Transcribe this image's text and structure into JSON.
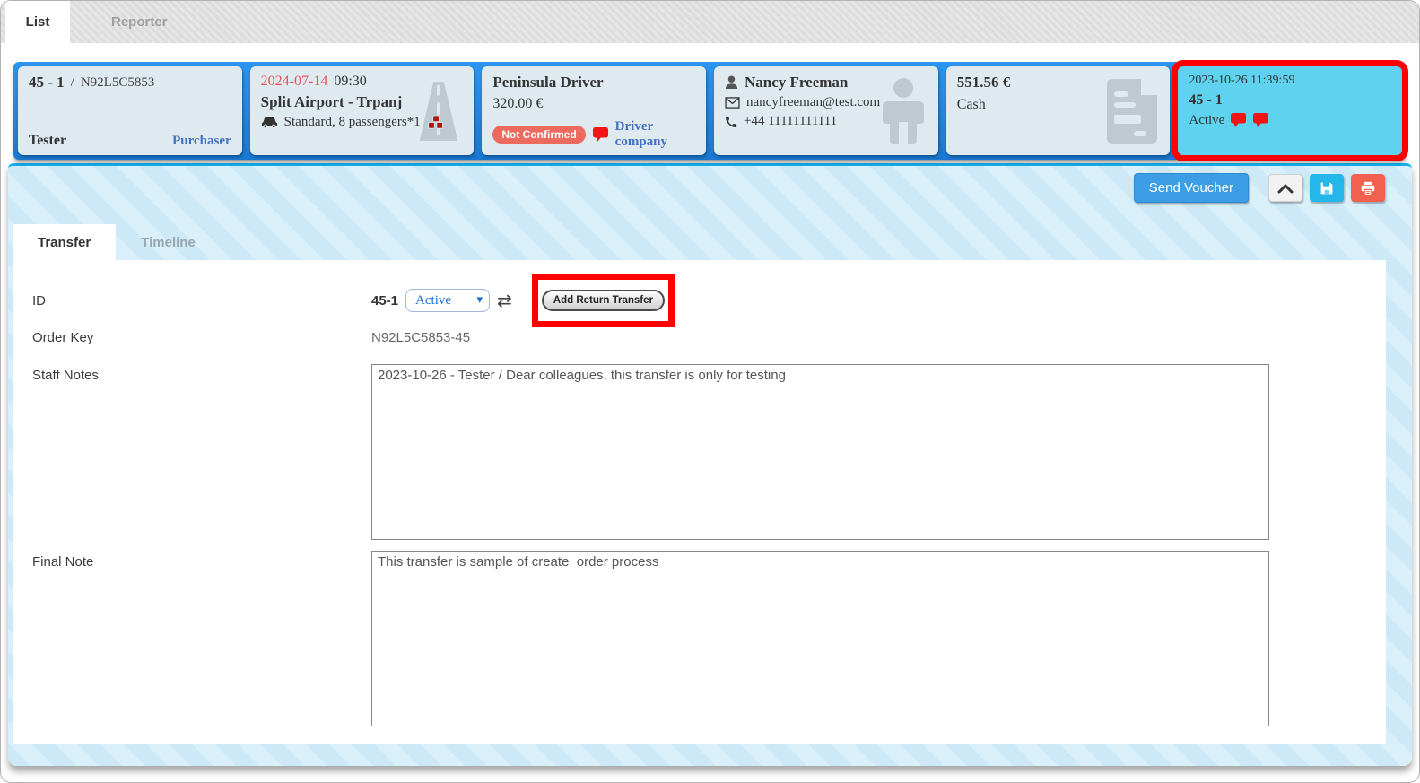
{
  "top_tabs": [
    {
      "label": "List"
    },
    {
      "label": "Reporter"
    }
  ],
  "cards": {
    "order": {
      "id": "45 - 1",
      "sep": "/",
      "code": "N92L5C5853",
      "customer": "Tester",
      "role_link": "Purchaser"
    },
    "trip": {
      "date": "2024-07-14",
      "time": "09:30",
      "route": "Split Airport - Trpanj",
      "vehicle": "Standard, 8 passengers*1"
    },
    "driver": {
      "name": "Peninsula Driver",
      "price": "320.00 €",
      "status_badge": "Not Confirmed",
      "company_link": "Driver company"
    },
    "customer": {
      "name": "Nancy Freeman",
      "email": "nancyfreeman@test.com",
      "phone": "+44 11111111111"
    },
    "payment": {
      "amount": "551.56 €",
      "method": "Cash"
    },
    "status": {
      "created": "2023-10-26 11:39:59",
      "id": "45 - 1",
      "state": "Active"
    }
  },
  "toolbar": {
    "send_voucher": "Send Voucher"
  },
  "detail_tabs": [
    {
      "label": "Transfer"
    },
    {
      "label": "Timeline"
    }
  ],
  "form": {
    "id": {
      "label": "ID",
      "value": "45-1",
      "status": "Active",
      "add_return": "Add Return Transfer"
    },
    "order_key": {
      "label": "Order Key",
      "value": "N92L5C5853-45"
    },
    "staff_notes": {
      "label": "Staff Notes",
      "value": "2023-10-26 - Tester / Dear colleagues, this transfer is only for testing"
    },
    "final_note": {
      "label": "Final Note",
      "value": "This transfer is sample of create  order process"
    }
  },
  "icons": {
    "swap": "⇄",
    "select_caret": "▾"
  },
  "colors": {
    "band_blue": "#1e88e5",
    "card_bg": "#dfe9f0",
    "highlight_card_bg": "#5ed2ee",
    "annotation_red": "#ff0000",
    "accent_cyan": "#25b6ea",
    "danger_red": "#f2604f",
    "link_blue": "#4472c4",
    "date_red": "#e25555",
    "badge_salmon": "#ed6a5e",
    "primary_button_blue": "#3c9ee5",
    "panel_stripe_blue": "#cde9f7"
  }
}
